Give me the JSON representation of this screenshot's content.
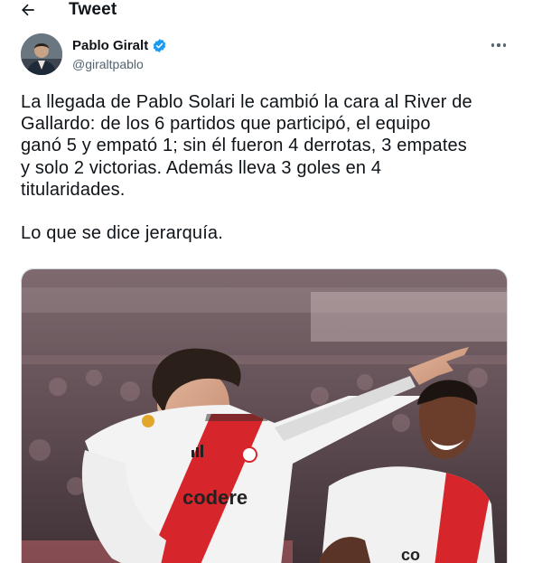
{
  "header": {
    "title": "Tweet",
    "back_icon": "arrow-left-icon"
  },
  "author": {
    "name": "Pablo Giralt",
    "handle": "@giraltpablo",
    "verified_icon": "verified-badge-icon",
    "verified_color": "#1d9bf0"
  },
  "more_icon": "more-dots-icon",
  "tweet": {
    "text": "La llegada de Pablo Solari le cambió la cara al River de\nGallardo: de los 6 partidos que participó, el equipo\nganó 5 y empató 1; sin él fueron 4 derrotas, 3 empates\ny solo 2 victorias. Además lleva 3 goles en 4\ntitularidades.\n\nLo que se dice jerarquía."
  },
  "media": {
    "jersey_sponsor": "codere"
  },
  "colors": {
    "text": "#0f1419",
    "secondary": "#536471",
    "river_red": "#d7262b"
  }
}
